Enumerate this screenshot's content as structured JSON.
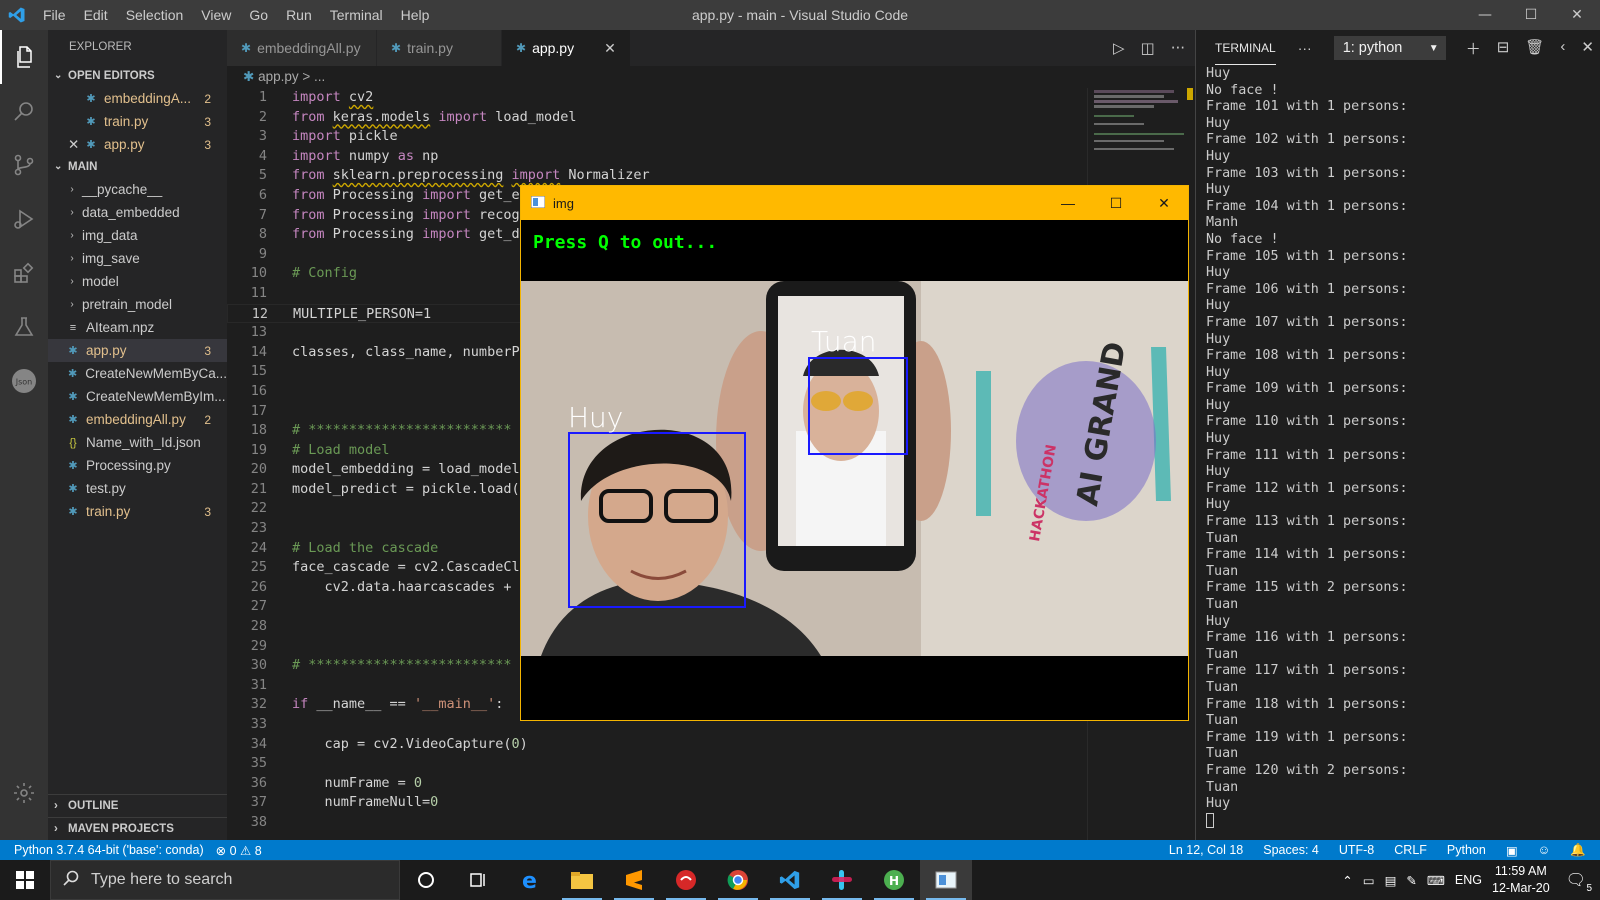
{
  "window": {
    "title": "app.py - main - Visual Studio Code",
    "menu": [
      "File",
      "Edit",
      "Selection",
      "View",
      "Go",
      "Run",
      "Terminal",
      "Help"
    ],
    "controls": {
      "minimize": "—",
      "maximize": "☐",
      "close": "✕"
    }
  },
  "sidebar": {
    "title": "EXPLORER",
    "open_editors_label": "OPEN EDITORS",
    "open_editors": [
      {
        "name": "embeddingA...",
        "badge": "2"
      },
      {
        "name": "train.py",
        "badge": "3"
      },
      {
        "name": "app.py",
        "badge": "3"
      }
    ],
    "folder_label": "MAIN",
    "items": [
      {
        "name": "__pycache__",
        "type": "folder"
      },
      {
        "name": "data_embedded",
        "type": "folder"
      },
      {
        "name": "img_data",
        "type": "folder"
      },
      {
        "name": "img_save",
        "type": "folder"
      },
      {
        "name": "model",
        "type": "folder"
      },
      {
        "name": "pretrain_model",
        "type": "folder"
      },
      {
        "name": "AIteam.npz",
        "type": "file"
      },
      {
        "name": "app.py",
        "type": "py",
        "badge": "3"
      },
      {
        "name": "CreateNewMemByCa...",
        "type": "py"
      },
      {
        "name": "CreateNewMemByIm...",
        "type": "py"
      },
      {
        "name": "embeddingAll.py",
        "type": "py",
        "badge": "2"
      },
      {
        "name": "Name_with_Id.json",
        "type": "json"
      },
      {
        "name": "Processing.py",
        "type": "py"
      },
      {
        "name": "test.py",
        "type": "py"
      },
      {
        "name": "train.py",
        "type": "py",
        "badge": "3"
      }
    ],
    "outline_label": "OUTLINE",
    "maven_label": "MAVEN PROJECTS"
  },
  "tabs": [
    {
      "label": "embeddingAll.py"
    },
    {
      "label": "train.py"
    },
    {
      "label": "app.py",
      "close": "✕"
    }
  ],
  "breadcrumb": {
    "file": "app.py",
    "rest": "> ..."
  },
  "code_lines": [
    "1",
    "2",
    "3",
    "4",
    "5",
    "6",
    "7",
    "8",
    "9",
    "10",
    "11",
    "12",
    "13",
    "14",
    "15",
    "16",
    "17",
    "18",
    "19",
    "20",
    "21",
    "22",
    "23",
    "24",
    "25",
    "26",
    "27",
    "28",
    "29",
    "30",
    "31",
    "32",
    "33",
    "34",
    "35",
    "36",
    "37",
    "38"
  ],
  "code": {
    "l1": [
      "import",
      " ",
      "cv2"
    ],
    "l2": [
      "from",
      " ",
      "keras.models",
      " ",
      "import",
      " load_model"
    ],
    "l3": [
      "import",
      " pickle"
    ],
    "l4": [
      "import",
      " numpy ",
      "as",
      " np"
    ],
    "l5": [
      "from",
      " ",
      "sklearn.preprocessing",
      " ",
      "import",
      " Normalizer"
    ],
    "l6": [
      "from",
      " Processing ",
      "import",
      " get_e"
    ],
    "l7": [
      "from",
      " Processing ",
      "import",
      " recog"
    ],
    "l8": [
      "from",
      " Processing ",
      "import",
      " get_d"
    ],
    "l10": "# Config",
    "l12": "MULTIPLE_PERSON=1",
    "l14": "classes, class_name, numberP",
    "l18": "# *************************",
    "l19": "# Load model",
    "l20": "model_embedding = load_model",
    "l21": "model_predict = pickle.load(",
    "l24": "# Load the cascade",
    "l25": "face_cascade = cv2.CascadeCl",
    "l26": "    cv2.data.haarcascades + ",
    "l30": "# *************************",
    "l32": [
      "if",
      " __name__ == ",
      "'__main__'",
      ":"
    ],
    "l34": [
      "    cap = cv2.VideoCapture(",
      "0",
      ")"
    ],
    "l36": [
      "    numFrame = ",
      "0"
    ],
    "l37": [
      "    numFrameNull=",
      "0"
    ]
  },
  "panel": {
    "title": "TERMINAL",
    "more": "···",
    "terminal_select": "1: python",
    "lines": [
      "Huy",
      "No face !",
      "Frame 101 with 1 persons:",
      "Huy",
      "Frame 102 with 1 persons:",
      "Huy",
      "Frame 103 with 1 persons:",
      "Huy",
      "Frame 104 with 1 persons:",
      "Manh",
      "No face !",
      "Frame 105 with 1 persons:",
      "Huy",
      "Frame 106 with 1 persons:",
      "Huy",
      "Frame 107 with 1 persons:",
      "Huy",
      "Frame 108 with 1 persons:",
      "Huy",
      "Frame 109 with 1 persons:",
      "Huy",
      "Frame 110 with 1 persons:",
      "Huy",
      "Frame 111 with 1 persons:",
      "Huy",
      "Frame 112 with 1 persons:",
      "Huy",
      "Frame 113 with 1 persons:",
      "Tuan",
      "Frame 114 with 1 persons:",
      "Tuan",
      "Frame 115 with 2 persons:",
      "Tuan",
      "Huy",
      "Frame 116 with 1 persons:",
      "Tuan",
      "Frame 117 with 1 persons:",
      "Tuan",
      "Frame 118 with 1 persons:",
      "Tuan",
      "Frame 119 with 1 persons:",
      "Tuan",
      "Frame 120 with 2 persons:",
      "Tuan",
      "Huy"
    ]
  },
  "statusbar": {
    "interpreter": "Python 3.7.4 64-bit ('base': conda)",
    "errors": "⊗ 0",
    "warnings": "⚠ 8",
    "position": "Ln 12, Col 18",
    "spaces": "Spaces: 4",
    "encoding": "UTF-8",
    "eol": "CRLF",
    "language": "Python"
  },
  "img_window": {
    "title": "img",
    "overlay_text": "Press Q to out...",
    "faces": [
      {
        "label": "Huy"
      },
      {
        "label": "Tuan"
      }
    ]
  },
  "taskbar": {
    "search_placeholder": "Type here to search",
    "lang": "ENG",
    "time": "11:59 AM",
    "date": "12-Mar-20",
    "notif_count": "5"
  },
  "colors": {
    "accent": "#007acc",
    "img_titlebar": "#ffb900",
    "face_box": "#1a1aff",
    "overlay_text": "#00ff00"
  }
}
